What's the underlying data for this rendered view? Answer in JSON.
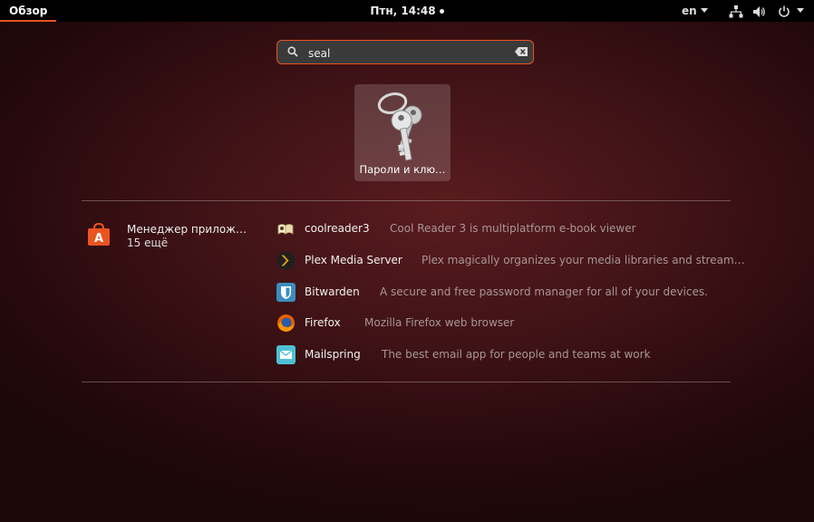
{
  "topbar": {
    "activities": "Обзор",
    "clock": "Птн, 14:48",
    "lang": "en"
  },
  "search": {
    "value": "seal"
  },
  "app_tile": {
    "label": "Пароли и клю…"
  },
  "provider": {
    "name": "Менеджер прилож…",
    "count": "15 ещё"
  },
  "results": [
    {
      "title": "coolreader3",
      "description": "Cool Reader 3 is multiplatform e-book viewer",
      "icon": "coolreader-icon"
    },
    {
      "title": "Plex Media Server",
      "description": "Plex magically organizes your media libraries and stream…",
      "icon": "plex-icon"
    },
    {
      "title": "Bitwarden",
      "description": "A secure and free password manager for all of your devices.",
      "icon": "bitwarden-icon"
    },
    {
      "title": "Firefox",
      "description": "Mozilla Firefox web browser",
      "icon": "firefox-icon"
    },
    {
      "title": "Mailspring",
      "description": "The best email app for people and teams at work",
      "icon": "mailspring-icon"
    }
  ],
  "colors": {
    "accent": "#e95420",
    "topbar": "#000000",
    "description_text": "#a89696"
  }
}
